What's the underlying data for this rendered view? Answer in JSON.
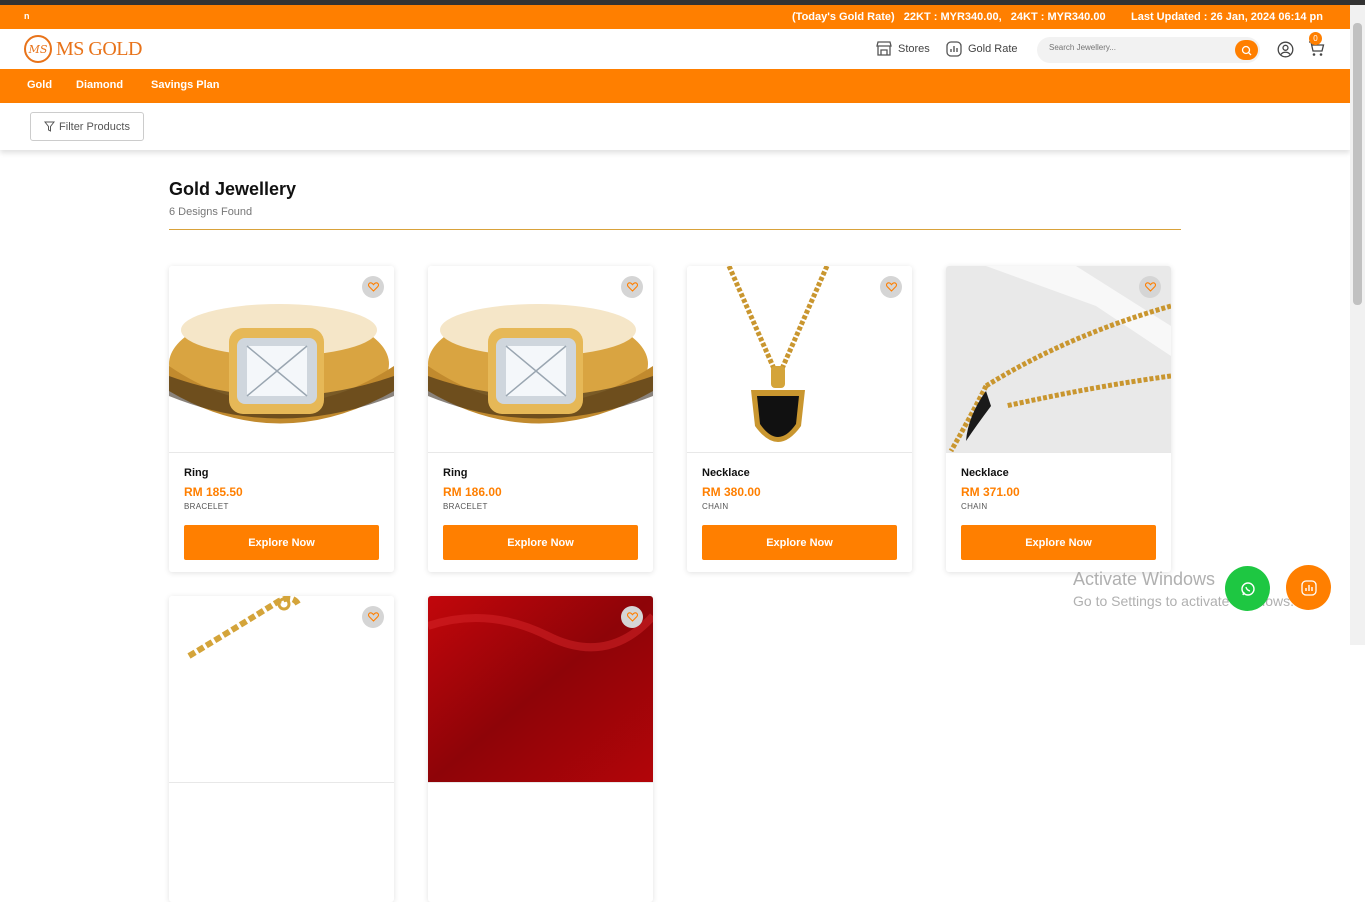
{
  "ticker": {
    "left_text": "n",
    "rate_text": "(Today's Gold Rate)   22KT : MYR340.00,   24KT : MYR340.00",
    "updated_text": "Last Updated : 26 Jan, 2024 06:14 pn"
  },
  "brand": {
    "logo_mark": "MS",
    "name": "MS GOLD"
  },
  "header": {
    "stores_label": "Stores",
    "gold_rate_label": "Gold Rate",
    "search_placeholder": "Search Jewellery...",
    "cart_count": "0"
  },
  "nav": {
    "items": [
      {
        "label": "Gold"
      },
      {
        "label": "Diamond"
      },
      {
        "label": "Savings Plan"
      }
    ]
  },
  "filter": {
    "label": "Filter Products"
  },
  "page": {
    "title": "Gold Jewellery",
    "count": "6 Designs Found"
  },
  "products": [
    {
      "name": "Ring",
      "price": "RM 185.50",
      "category": "BRACELET",
      "button": "Explore Now",
      "image": "gold-ring-emerald-cut-diamond"
    },
    {
      "name": "Ring",
      "price": "RM 186.00",
      "category": "BRACELET",
      "button": "Explore Now",
      "image": "gold-ring-emerald-cut-diamond"
    },
    {
      "name": "Necklace",
      "price": "RM 380.00",
      "category": "CHAIN",
      "button": "Explore Now",
      "image": "gold-chain-black-shield-pendant"
    },
    {
      "name": "Necklace",
      "price": "RM 371.00",
      "category": "CHAIN",
      "button": "Explore Now",
      "image": "gold-chain-horn-pendant"
    },
    {
      "image": "gold-link-bracelet"
    },
    {
      "image": "red-fabric-background"
    }
  ],
  "os_overlay": {
    "line1": "Activate Windows",
    "line2": "Go to Settings to activate Windows."
  },
  "colors": {
    "accent": "#ff7f00",
    "whatsapp": "#1ec742",
    "divider": "#d9a23a"
  }
}
